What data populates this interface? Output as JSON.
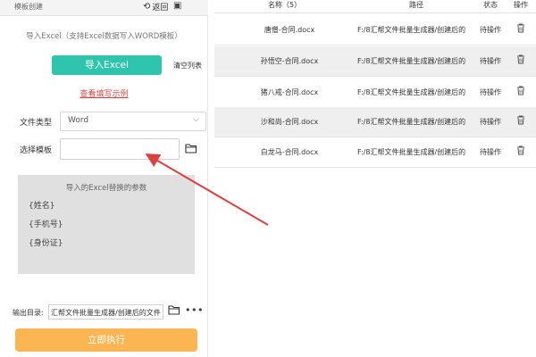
{
  "topbar": {
    "title": "模板创建",
    "back_label": "返回"
  },
  "left": {
    "import_hint": "导入Excel（支持Excel数据写入WORD模板）",
    "import_button": "导入Excel",
    "clear_list": "清空列表",
    "example_link": "查看填写示例",
    "file_type_label": "文件类型",
    "file_type_value": "Word",
    "template_label": "选择模板",
    "template_value": "",
    "params_title": "导入的Excel替换的参数",
    "params": [
      "{姓名}",
      "{手机号}",
      "{身份证}"
    ],
    "output_label": "输出目录:",
    "output_path": "汇帮文件批量生成器/创建后的文件",
    "run_button": "立即执行"
  },
  "table": {
    "headers": {
      "name": "名称（5）",
      "path": "路径",
      "status": "状态",
      "action": "操作"
    },
    "rows": [
      {
        "name": "唐僧-合同.docx",
        "path": "F:/8汇帮文件批量生成器/创建后的",
        "status": "待操作"
      },
      {
        "name": "孙悟空-合同.docx",
        "path": "F:/8汇帮文件批量生成器/创建后的",
        "status": "待操作"
      },
      {
        "name": "猪八戒-合同.docx",
        "path": "F:/8汇帮文件批量生成器/创建后的",
        "status": "待操作"
      },
      {
        "name": "沙和尚-合同.docx",
        "path": "F:/8汇帮文件批量生成器/创建后的",
        "status": "待操作"
      },
      {
        "name": "白龙马-合同.docx",
        "path": "F:/8汇帮文件批量生成器/创建后的",
        "status": "待操作"
      }
    ]
  },
  "colors": {
    "import_button": "#2ec4ad",
    "run_button": "#fbb653",
    "example_link": "#d9423f",
    "arrow": "#d9423f",
    "param_box": "#e0e0e0"
  },
  "icons": {
    "back": "undo-arrow-icon",
    "save": "save-icon",
    "folder": "folder-icon",
    "delete": "trash-icon",
    "more": "more-dots-icon",
    "dropdown": "chevron-down-icon"
  }
}
